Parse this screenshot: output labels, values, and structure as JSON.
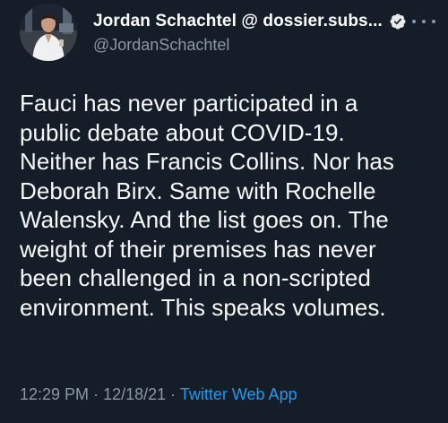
{
  "tweet": {
    "author": {
      "display_name": "Jordan Schachtel @ dossier.subs...",
      "handle": "@JordanSchachtel",
      "verified_icon": "verified-badge-icon",
      "avatar_icon": "profile-photo"
    },
    "more_icon": "more-options-icon",
    "text": "Fauci has never participated in a\npublic debate about COVID-19.\nNeither has Francis Collins. Nor has\nDeborah Birx. Same with Rochelle\nWalensky. And the list goes on. The\nweight of their premises has never\nbeen challenged in a non-scripted\nenvironment. This speaks volumes.",
    "meta": {
      "time": "12:29 PM",
      "separator": "·",
      "date": "12/18/21",
      "source": "Twitter Web App"
    }
  },
  "colors": {
    "background": "#141d28",
    "text": "#f7f9f9",
    "muted": "#8b98a5",
    "link": "#1d9bf0"
  }
}
